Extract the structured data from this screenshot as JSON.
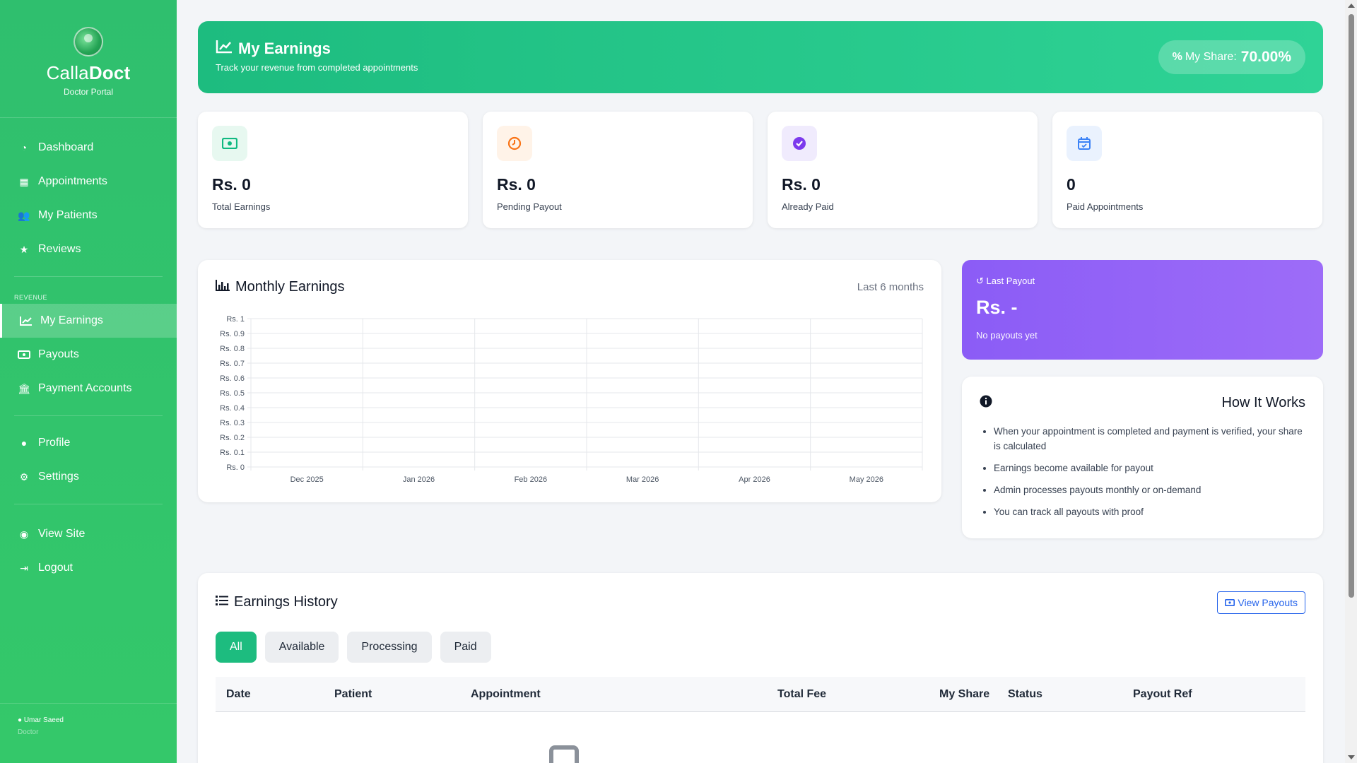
{
  "brand": {
    "name_light": "Calla",
    "name_bold": "Doct",
    "subtitle": "Doctor Portal"
  },
  "sidebar": {
    "main_items": [
      {
        "label": "Dashboard",
        "icon": "dashboard-icon"
      },
      {
        "label": "Appointments",
        "icon": "calendar-icon"
      },
      {
        "label": "My Patients",
        "icon": "users-icon"
      },
      {
        "label": "Reviews",
        "icon": "star-icon"
      }
    ],
    "section_label": "REVENUE",
    "revenue_items": [
      {
        "label": "My Earnings",
        "icon": "chart-line-icon",
        "active": true
      },
      {
        "label": "Payouts",
        "icon": "money-icon"
      },
      {
        "label": "Payment Accounts",
        "icon": "bank-icon"
      }
    ],
    "account_items": [
      {
        "label": "Profile",
        "icon": "user-icon"
      },
      {
        "label": "Settings",
        "icon": "gear-icon"
      }
    ],
    "site_items": [
      {
        "label": "View Site",
        "icon": "globe-icon"
      },
      {
        "label": "Logout",
        "icon": "logout-icon"
      }
    ],
    "user": {
      "name": "Umar Saeed",
      "role": "Doctor"
    }
  },
  "header": {
    "title": "My Earnings",
    "subtitle": "Track your revenue from completed appointments",
    "share_label": "My Share:",
    "share_value": "70.00%"
  },
  "stats": [
    {
      "value": "Rs. 0",
      "label": "Total Earnings",
      "icon": "money-icon",
      "color": "#10b981",
      "bg": "#e7f8f0"
    },
    {
      "value": "Rs. 0",
      "label": "Pending Payout",
      "icon": "clock-icon",
      "color": "#f97316",
      "bg": "#fff3e8"
    },
    {
      "value": "Rs. 0",
      "label": "Already Paid",
      "icon": "check-circle-icon",
      "color": "#7c3aed",
      "bg": "#f0ebfd"
    },
    {
      "value": "0",
      "label": "Paid Appointments",
      "icon": "calendar-check-icon",
      "color": "#3b82f6",
      "bg": "#eaf2fe"
    }
  ],
  "chart": {
    "title": "Monthly Earnings",
    "note": "Last 6 months"
  },
  "chart_data": {
    "type": "line",
    "title": "Monthly Earnings",
    "categories": [
      "Dec 2025",
      "Jan 2026",
      "Feb 2026",
      "Mar 2026",
      "Apr 2026",
      "May 2026"
    ],
    "series": [
      {
        "values": [
          0,
          0,
          0,
          0,
          0,
          0
        ]
      }
    ],
    "ylim": [
      0,
      1
    ],
    "yticks": [
      "Rs. 0",
      "Rs. 0.1",
      "Rs. 0.2",
      "Rs. 0.3",
      "Rs. 0.4",
      "Rs. 0.5",
      "Rs. 0.6",
      "Rs. 0.7",
      "Rs. 0.8",
      "Rs. 0.9",
      "Rs. 1"
    ],
    "grid": true
  },
  "last_payout": {
    "label": "Last Payout",
    "value": "Rs. -",
    "sub": "No payouts yet"
  },
  "how_it_works": {
    "title": "How It Works",
    "items": [
      "When your appointment is completed and payment is verified, your share is calculated",
      "Earnings become available for payout",
      "Admin processes payouts monthly or on-demand",
      "You can track all payouts with proof"
    ]
  },
  "history": {
    "title": "Earnings History",
    "view_button": "View Payouts",
    "tabs": [
      "All",
      "Available",
      "Processing",
      "Paid"
    ],
    "active_tab": "All",
    "columns": [
      "Date",
      "Patient",
      "Appointment",
      "Total Fee",
      "My Share",
      "Status",
      "Payout Ref"
    ]
  }
}
